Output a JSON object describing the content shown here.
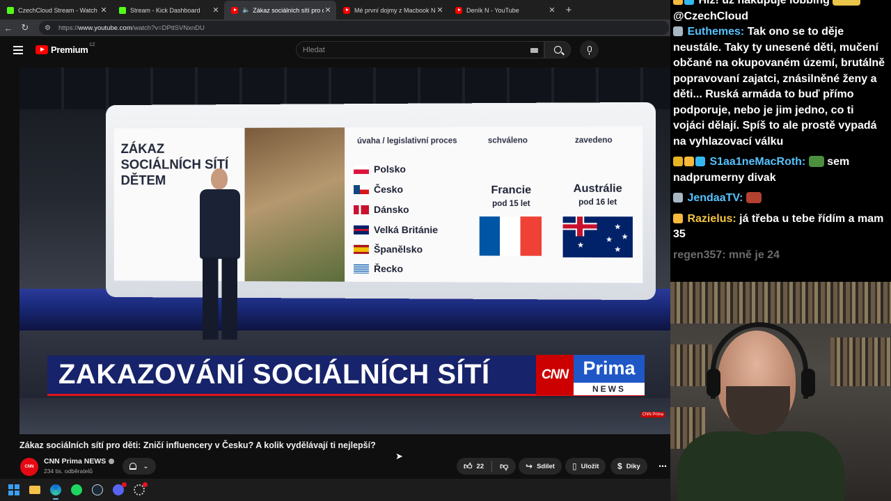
{
  "browser": {
    "tabs": [
      {
        "title": "CzechCloud Stream - Watch Live o",
        "icon": "kick-icon",
        "active": false
      },
      {
        "title": "Stream - Kick Dashboard",
        "icon": "kick-icon",
        "active": false
      },
      {
        "title": "Zákaz sociálních sítí pro děti:",
        "icon": "youtube-icon",
        "active": true,
        "audio": true
      },
      {
        "title": "Mé první dojmy z Macbook Neo.",
        "icon": "youtube-icon",
        "active": false
      },
      {
        "title": "Deník N - YouTube",
        "icon": "youtube-icon",
        "active": false
      }
    ],
    "url_prefix": "https://",
    "url_host": "www.youtube.com",
    "url_path": "/watch?v=DPtlSVNxnDU"
  },
  "youtube": {
    "logo": "Premium",
    "country": "CZ",
    "search_placeholder": "Hledat"
  },
  "video": {
    "graphic": {
      "topic": "ZÁKAZ SOCIÁLNÍCH SÍTÍ DĚTEM",
      "col1": "úvaha / legislativní proces",
      "col2": "schváleno",
      "col3": "zavedeno",
      "countries": [
        "Polsko",
        "Česko",
        "Dánsko",
        "Velká Británie",
        "Španělsko",
        "Řecko"
      ],
      "approved": {
        "country": "Francie",
        "age": "pod 15 let"
      },
      "introduced": {
        "country": "Austrálie",
        "age": "pod 16 let"
      }
    },
    "headline": "ZAKAZOVÁNÍ SOCIÁLNÍCH SÍTÍ",
    "brand_cnn": "CNN",
    "brand_prima": "Prima",
    "brand_news": "NEWS",
    "watermark": "CNN Prima"
  },
  "meta": {
    "title": "Zákaz sociálních sítí pro děti: Zničí influencery v Česku? A kolik vydělávají ti nejlepší?",
    "channel": "CNN Prima NEWS",
    "subscribers": "234 tis. odběratelů",
    "likes": "22",
    "share": "Sdílet",
    "save": "Uložit",
    "thanks": "Díky"
  },
  "chat": [
    {
      "user": "",
      "text": "Hiz! už nakupuje lobbing",
      "mention": "@CzechCloud"
    },
    {
      "user": "Euthemes:",
      "user_color": "#56c3ff",
      "text": "Tak ono se to děje neustále. Taky ty unesené děti, mučení občané na okupovaném území, brutálně popravovaní zajatci, znásilněné ženy a děti... Ruská armáda to buď přímo podporuje, nebo je jim jedno, co ti vojáci dělají. Spíš to ale prostě vypadá na vyhlazovací válku"
    },
    {
      "user": "S1aa1neMacRoth:",
      "user_color": "#56c3ff",
      "text": "sem nadprumerny divak"
    },
    {
      "user": "JendaaTV:",
      "user_color": "#56c3ff",
      "text": ""
    },
    {
      "user": "Razielus:",
      "user_color": "#f4c542",
      "text": "já třeba u tebe řídím a mam 35"
    },
    {
      "user": "regen357:",
      "user_color": "#6b6b6b",
      "text": "mně je 24",
      "faded": true
    }
  ]
}
